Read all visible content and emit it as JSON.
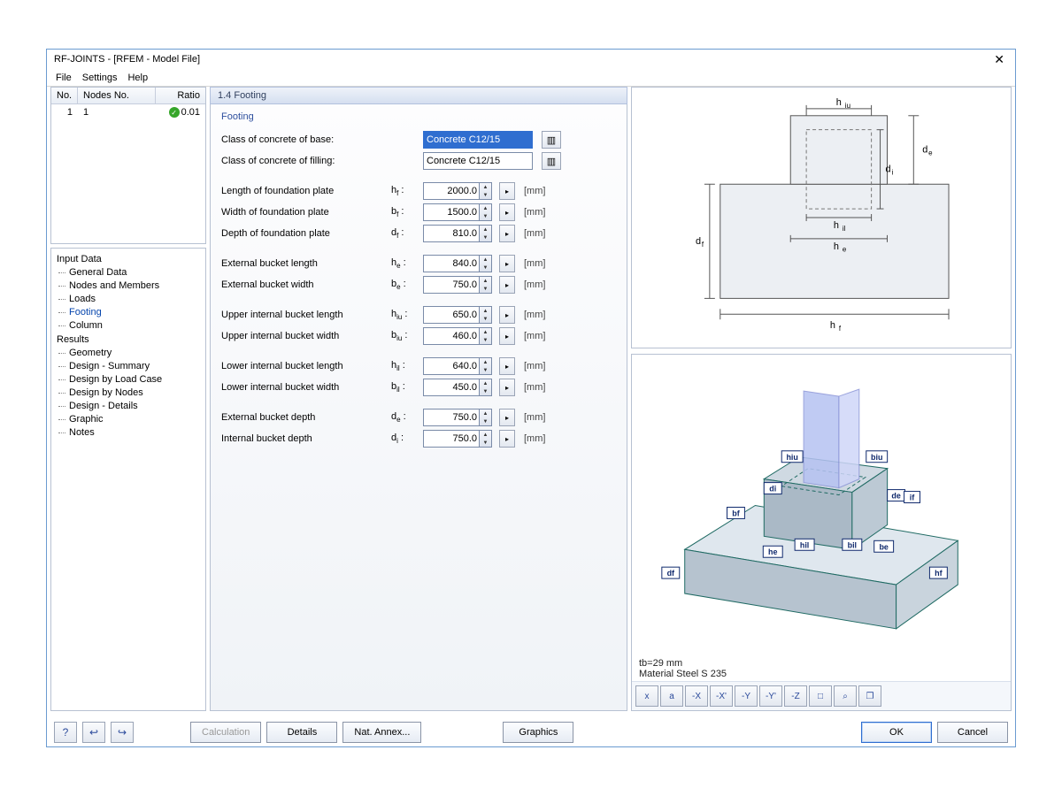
{
  "window": {
    "title": "RF-JOINTS - [RFEM - Model File]"
  },
  "menu": {
    "file": "File",
    "settings": "Settings",
    "help": "Help"
  },
  "list": {
    "headers": {
      "no": "No.",
      "nodes": "Nodes No.",
      "ratio": "Ratio"
    },
    "rows": [
      {
        "no": "1",
        "nodes": "1",
        "ratio": "0.01"
      }
    ]
  },
  "tree": {
    "input_data": "Input Data",
    "general": "General Data",
    "nodes_members": "Nodes and Members",
    "loads": "Loads",
    "footing": "Footing",
    "column": "Column",
    "results": "Results",
    "geometry": "Geometry",
    "design_summary": "Design - Summary",
    "design_loadcase": "Design by Load Case",
    "design_nodes": "Design by Nodes",
    "design_details": "Design - Details",
    "graphic": "Graphic",
    "notes": "Notes"
  },
  "section": {
    "title": "1.4 Footing",
    "group": "Footing"
  },
  "fields": {
    "class_base": {
      "label": "Class of concrete of base:",
      "value": "Concrete C12/15"
    },
    "class_fill": {
      "label": "Class of concrete of filling:",
      "value": "Concrete C12/15"
    },
    "hf": {
      "label": "Length of foundation plate",
      "sym": "h",
      "sub": "f",
      "value": "2000.0",
      "unit": "[mm]"
    },
    "bf": {
      "label": "Width of foundation plate",
      "sym": "b",
      "sub": "f",
      "value": "1500.0",
      "unit": "[mm]"
    },
    "df": {
      "label": "Depth of foundation plate",
      "sym": "d",
      "sub": "f",
      "value": "810.0",
      "unit": "[mm]"
    },
    "he": {
      "label": "External bucket length",
      "sym": "h",
      "sub": "e",
      "value": "840.0",
      "unit": "[mm]"
    },
    "be": {
      "label": "External bucket width",
      "sym": "b",
      "sub": "e",
      "value": "750.0",
      "unit": "[mm]"
    },
    "hiu": {
      "label": "Upper internal bucket length",
      "sym": "h",
      "sub": "iu",
      "value": "650.0",
      "unit": "[mm]"
    },
    "biu": {
      "label": "Upper internal bucket width",
      "sym": "b",
      "sub": "iu",
      "value": "460.0",
      "unit": "[mm]"
    },
    "hil": {
      "label": "Lower internal bucket length",
      "sym": "h",
      "sub": "il",
      "value": "640.0",
      "unit": "[mm]"
    },
    "bil": {
      "label": "Lower internal bucket width",
      "sym": "b",
      "sub": "il",
      "value": "450.0",
      "unit": "[mm]"
    },
    "de": {
      "label": "External bucket depth",
      "sym": "d",
      "sub": "e",
      "value": "750.0",
      "unit": "[mm]"
    },
    "di": {
      "label": "Internal bucket depth",
      "sym": "d",
      "sub": "i",
      "value": "750.0",
      "unit": "[mm]"
    }
  },
  "diagram": {
    "hiu": "hiu",
    "hil": "hil",
    "he": "he",
    "hf": "hf",
    "de": "de",
    "di": "di",
    "df": "df"
  },
  "diagram3d": {
    "tb": "tb=29 mm",
    "material": "Material Steel S 235",
    "labels": {
      "hiu": "hiu",
      "biu": "biu",
      "hil": "hil",
      "bil": "bil",
      "he": "he",
      "be": "be",
      "hf": "hf",
      "bf": "bf",
      "de": "de",
      "di": "di",
      "df": "df",
      "if": "if"
    }
  },
  "toolbar3d": {
    "b0": "x",
    "b1": "a",
    "b2": "-X",
    "b3": "-X'",
    "b4": "-Y",
    "b5": "-Y'",
    "b6": "-Z",
    "b7": "□",
    "b8": "⌕",
    "b9": "❐"
  },
  "footer": {
    "help_tip": "?",
    "calc": "Calculation",
    "details": "Details",
    "annex": "Nat. Annex...",
    "graphics": "Graphics",
    "ok": "OK",
    "cancel": "Cancel"
  }
}
